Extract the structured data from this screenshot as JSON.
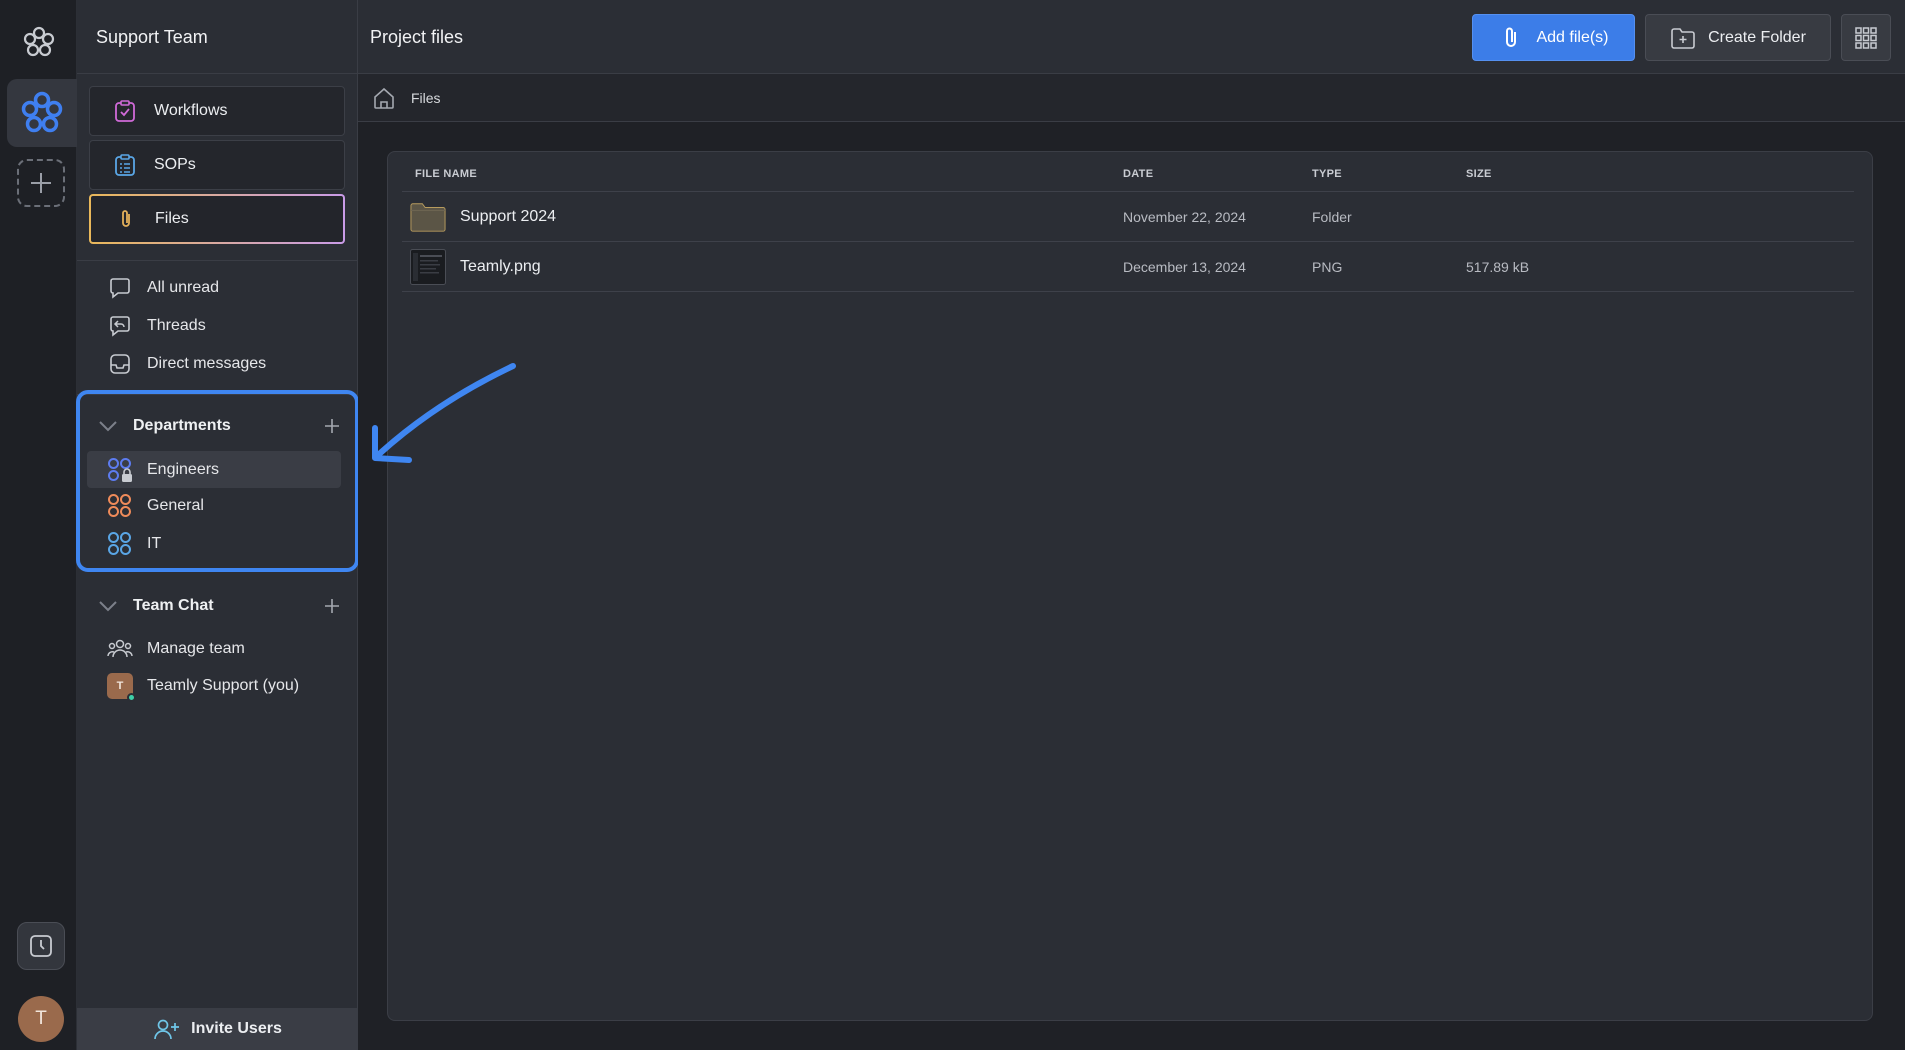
{
  "sidebar": {
    "team_name": "Support Team",
    "nav": [
      {
        "label": "Workflows",
        "icon": "clipboard-check-icon",
        "color": "#d06ad8"
      },
      {
        "label": "SOPs",
        "icon": "clipboard-list-icon",
        "color": "#5aa6e6"
      },
      {
        "label": "Files",
        "icon": "paperclip-icon",
        "color": "#e3b05a",
        "active": true
      }
    ],
    "inbox": [
      {
        "label": "All unread",
        "icon": "chat-bubble-icon"
      },
      {
        "label": "Threads",
        "icon": "reply-icon"
      },
      {
        "label": "Direct messages",
        "icon": "inbox-icon"
      }
    ],
    "departments": {
      "label": "Departments",
      "items": [
        {
          "label": "Engineers",
          "icon": "channel-locked-icon",
          "color": "#5d7cf0"
        },
        {
          "label": "General",
          "icon": "channel-icon",
          "color": "#ef8b5a"
        },
        {
          "label": "IT",
          "icon": "channel-icon",
          "color": "#5aa6e6"
        }
      ]
    },
    "team_chat": {
      "label": "Team Chat",
      "items": [
        {
          "label": "Manage team",
          "icon": "people-icon"
        },
        {
          "label": "Teamly Support (you)",
          "icon": "user-avatar",
          "initial": "T"
        }
      ]
    },
    "invite_label": "Invite Users"
  },
  "rail": {
    "avatar_initial": "T"
  },
  "main": {
    "title": "Project files",
    "add_files_label": "Add file(s)",
    "create_folder_label": "Create Folder",
    "breadcrumb": "Files",
    "table": {
      "headers": [
        "FILE NAME",
        "DATE",
        "TYPE",
        "SIZE"
      ],
      "rows": [
        {
          "name": "Support 2024",
          "date": "November 22, 2024",
          "type": "Folder",
          "size": "",
          "icon": "folder-icon"
        },
        {
          "name": "Teamly.png",
          "date": "December 13, 2024",
          "type": "PNG",
          "size": "517.89 kB",
          "icon": "image-thumbnail"
        }
      ]
    }
  },
  "colors": {
    "accent": "#3c7de8",
    "highlight": "#3f86f1",
    "online": "#3fd0a8"
  }
}
